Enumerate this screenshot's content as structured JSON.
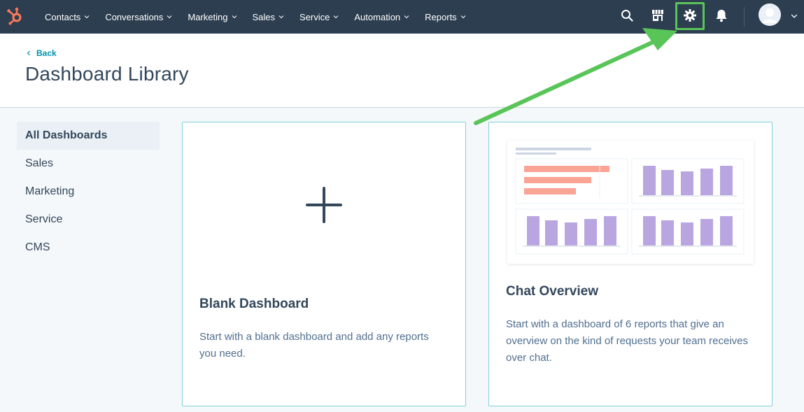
{
  "topnav": {
    "items": [
      {
        "label": "Contacts"
      },
      {
        "label": "Conversations"
      },
      {
        "label": "Marketing"
      },
      {
        "label": "Sales"
      },
      {
        "label": "Service"
      },
      {
        "label": "Automation"
      },
      {
        "label": "Reports"
      }
    ],
    "icons": [
      "search-icon",
      "marketplace-icon",
      "settings-icon",
      "notifications-icon",
      "avatar"
    ]
  },
  "header": {
    "back_label": "Back",
    "title": "Dashboard Library"
  },
  "sidebar": {
    "items": [
      {
        "label": "All Dashboards",
        "active": true
      },
      {
        "label": "Sales"
      },
      {
        "label": "Marketing"
      },
      {
        "label": "Service"
      },
      {
        "label": "CMS"
      }
    ]
  },
  "cards": [
    {
      "title": "Blank Dashboard",
      "description": "Start with a blank dashboard and add any reports you need."
    },
    {
      "title": "Chat Overview",
      "description": "Start with a dashboard of 6 reports that give an overview on the kind of requests your team receives over chat."
    }
  ],
  "colors": {
    "nav_bg": "#2d3e50",
    "accent_link": "#0091ae",
    "card_border": "#7fd1de",
    "highlight": "#59c559",
    "bar_purple": "#b9a6e0",
    "bar_salmon": "#f9a494",
    "logo_orange": "#ff7a59"
  }
}
